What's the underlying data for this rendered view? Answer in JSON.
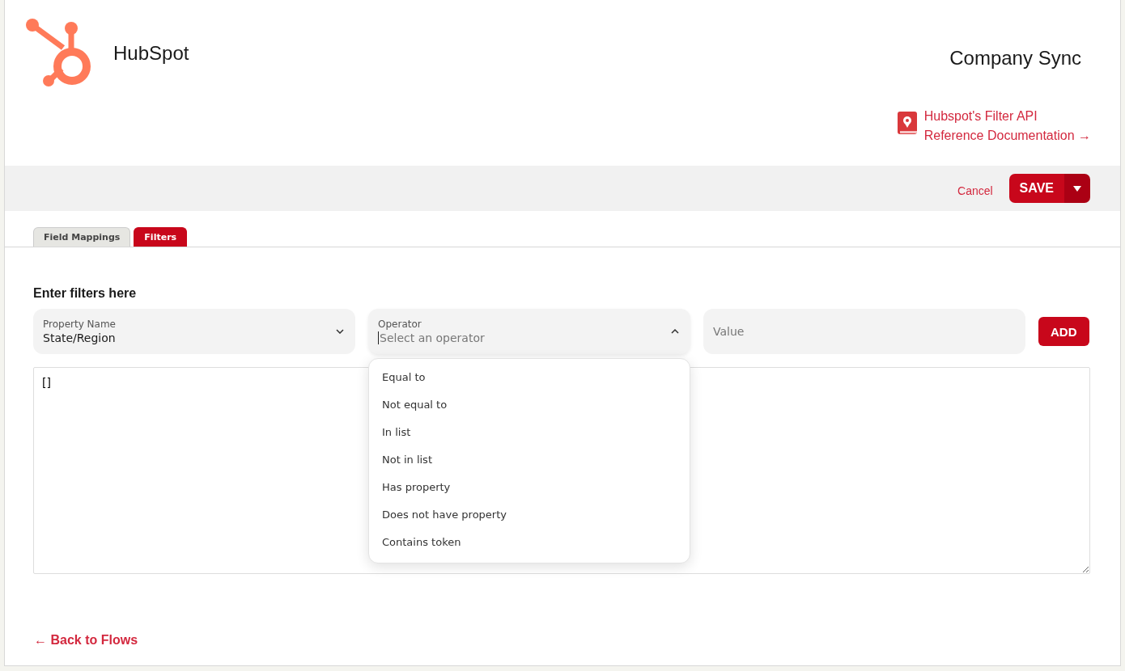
{
  "header": {
    "brand": "HubSpot",
    "title": "Company Sync",
    "doc_link": {
      "line_1": "Hubspot's Filter API",
      "line_2": "Reference Documentation →"
    }
  },
  "actions": {
    "cancel": "Cancel",
    "save": "SAVE"
  },
  "tabs": [
    {
      "label": "Field Mappings",
      "selected": false
    },
    {
      "label": "Filters",
      "selected": true
    }
  ],
  "filters": {
    "heading": "Enter filters here",
    "property": {
      "label": "Property Name",
      "value": "State/Region"
    },
    "operator": {
      "label": "Operator",
      "placeholder": "Select an operator",
      "expanded": true,
      "options": [
        "Equal to",
        "Not equal to",
        "In list",
        "Not in list",
        "Has property",
        "Does not have property",
        "Contains token"
      ]
    },
    "value": {
      "placeholder": "Value"
    },
    "add": "ADD",
    "json_text": "[]"
  },
  "back_link": "← Back to Flows"
}
